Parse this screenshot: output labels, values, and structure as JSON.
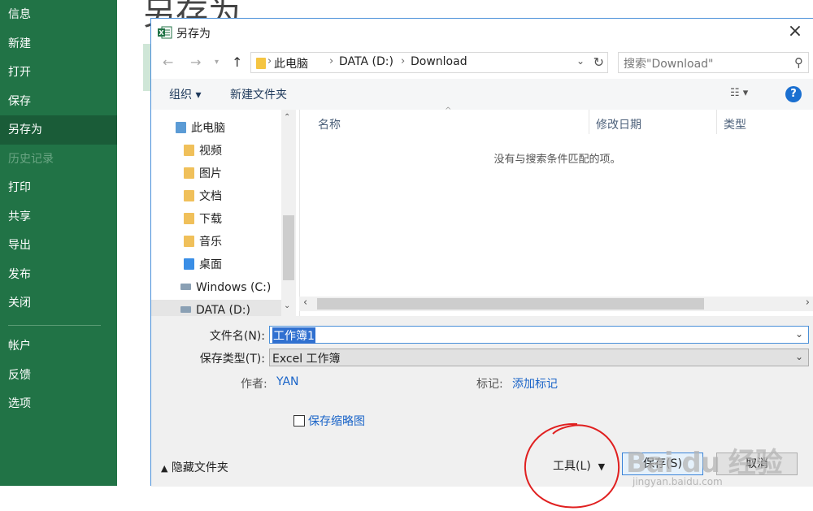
{
  "backstage": {
    "title": "另存为",
    "nav": [
      {
        "label": "信息"
      },
      {
        "label": "新建"
      },
      {
        "label": "打开"
      },
      {
        "label": "保存"
      },
      {
        "label": "另存为",
        "active": true
      },
      {
        "label": "历史记录",
        "disabled": true
      },
      {
        "label": "打印"
      },
      {
        "label": "共享"
      },
      {
        "label": "导出"
      },
      {
        "label": "发布"
      },
      {
        "label": "关闭"
      },
      {
        "label": "帐户"
      },
      {
        "label": "反馈"
      },
      {
        "label": "选项"
      }
    ]
  },
  "dialog": {
    "title": "另存为",
    "address": {
      "crumbs": [
        "此电脑",
        "DATA (D:)",
        "Download"
      ]
    },
    "search_placeholder": "搜索\"Download\"",
    "commands": {
      "organize": "组织 ▾",
      "new_folder": "新建文件夹"
    },
    "tree": [
      {
        "label": "此电脑",
        "icon": "computer-icon"
      },
      {
        "label": "视频",
        "icon": "video-folder-icon"
      },
      {
        "label": "图片",
        "icon": "pictures-folder-icon"
      },
      {
        "label": "文档",
        "icon": "documents-folder-icon"
      },
      {
        "label": "下载",
        "icon": "downloads-folder-icon"
      },
      {
        "label": "音乐",
        "icon": "music-folder-icon"
      },
      {
        "label": "桌面",
        "icon": "desktop-folder-icon"
      },
      {
        "label": "Windows (C:)",
        "icon": "drive-icon"
      },
      {
        "label": "DATA (D:)",
        "icon": "drive-icon"
      }
    ],
    "columns": [
      "名称",
      "修改日期",
      "类型"
    ],
    "empty_message": "没有与搜索条件匹配的项。",
    "form": {
      "filename_label": "文件名(N):",
      "filename_value": "工作簿1",
      "filetype_label": "保存类型(T):",
      "filetype_value": "Excel 工作簿",
      "author_label": "作者:",
      "author_value": "YAN",
      "tags_label": "标记:",
      "tags_value": "添加标记",
      "thumbnail_label": "保存缩略图"
    },
    "buttons": {
      "hide_folders": "隐藏文件夹",
      "tools": "工具(L)",
      "save": "保存(S)",
      "cancel": "取消"
    }
  },
  "watermark": {
    "logo": "Bai du 经验",
    "url": "jingyan.baidu.com"
  },
  "colors": {
    "excel_green": "#217346",
    "accent_blue": "#1a64c8",
    "annotation_red": "#e02020"
  }
}
